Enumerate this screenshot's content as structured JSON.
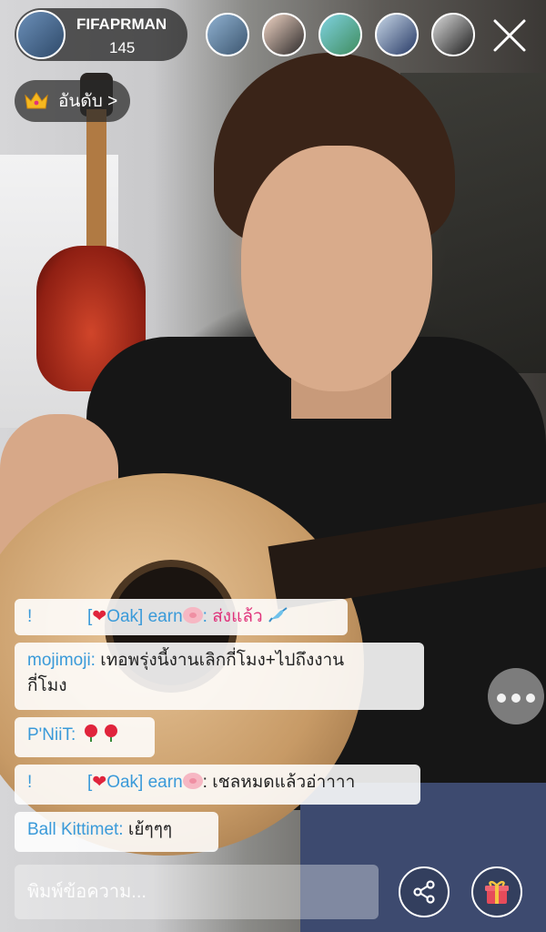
{
  "host": {
    "name": "FIFAPRMAN",
    "count": "145"
  },
  "rank": {
    "label": "อันดับ >"
  },
  "viewers": [
    "viewer-1",
    "viewer-2",
    "viewer-3",
    "viewer-4",
    "viewer-5"
  ],
  "chat": [
    {
      "prefix": "!",
      "tag": "Oak] earn",
      "text": "ส่งแล้ว",
      "tag_open": "["
    },
    {
      "user": "mojimoji:",
      "text": "เทอพรุ่งนี้งานเลิกกี่โมง+ไปถึงงาน",
      "text2": "กี่โมง"
    },
    {
      "user": "P'NiiT:"
    },
    {
      "prefix": "!",
      "tag_open": "[",
      "tag": "Oak] earn",
      "text": ": เชลหมดแล้วอ่าาาา"
    },
    {
      "user": "Ball Kittimet:",
      "text": "เย้ๆๆๆ"
    }
  ],
  "input": {
    "placeholder": "พิมพ์ข้อความ..."
  },
  "icons": {
    "close": "close-icon",
    "share": "share-icon",
    "gift": "gift-icon",
    "crown": "crown-icon",
    "more": "more-icon"
  },
  "colors": {
    "username": "#3a9ad9",
    "highlight": "#e0327a",
    "heart": "#e0243c",
    "gift": "#e64b5a"
  }
}
